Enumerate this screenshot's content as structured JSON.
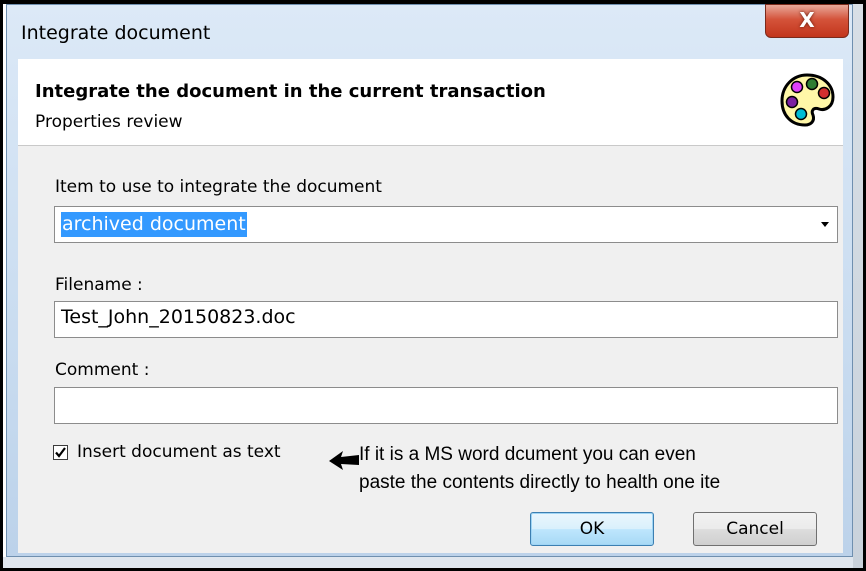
{
  "window": {
    "title": "Integrate document",
    "close_label": "X"
  },
  "header": {
    "title": "Integrate the document in the current transaction",
    "subtitle": "Properties review",
    "icon": "palette-icon"
  },
  "form": {
    "item_label": "Item to use to integrate the document",
    "item_value": "archived document",
    "filename_label": "Filename :",
    "filename_value": "Test_John_20150823.doc",
    "comment_label": "Comment :",
    "comment_value": "",
    "insert_checkbox_label": "Insert document as text",
    "insert_checked": true
  },
  "annotation": {
    "line1": "If it is a MS word dcument you can even",
    "line2": "paste the contents directly to health one ite"
  },
  "buttons": {
    "ok": "OK",
    "cancel": "Cancel"
  }
}
